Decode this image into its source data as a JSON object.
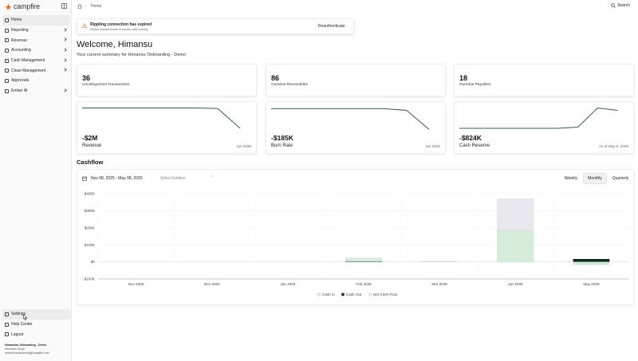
{
  "brand": {
    "name": "campfire"
  },
  "sidebar": {
    "items": [
      {
        "label": "Home",
        "active": true,
        "chevron": false
      },
      {
        "label": "Reporting",
        "active": false,
        "chevron": true
      },
      {
        "label": "Revenue",
        "active": false,
        "chevron": true
      },
      {
        "label": "Accounting",
        "active": false,
        "chevron": true
      },
      {
        "label": "Cash Management",
        "active": false,
        "chevron": true
      },
      {
        "label": "Close Management",
        "active": false,
        "chevron": true
      },
      {
        "label": "Approvals",
        "active": false,
        "chevron": false
      },
      {
        "label": "Ember AI",
        "active": false,
        "chevron": true
      }
    ],
    "bottom": [
      {
        "label": "Settings"
      },
      {
        "label": "Help Center"
      },
      {
        "label": "Logout"
      }
    ],
    "org": {
      "name": "Himanshu Onboarding - Demo",
      "user": "Himanshu Singh",
      "email": "himanshuonboarding@campfire.com"
    }
  },
  "topbar": {
    "breadcrumb": "Home",
    "search_label": "Search"
  },
  "alert": {
    "title": "Rippling connection has expired",
    "subtitle": "Please reauthenticate to resolve data syncing.",
    "button": "Reauthenticate"
  },
  "welcome": {
    "title": "Welcome, Himansu",
    "subtitle": "Your current summary for Himansu Onboarding - Demo"
  },
  "stats": [
    {
      "value": "36",
      "label": "Uncategorized Transactions"
    },
    {
      "value": "86",
      "label": "Overdue Receivables"
    },
    {
      "value": "18",
      "label": "Overdue Payables"
    }
  ],
  "metrics": [
    {
      "value": "-$2M",
      "label": "Revenue",
      "date": "Apr 2026",
      "trend": [
        0.95,
        0.95,
        0.95,
        0.95,
        0.95,
        0.95,
        0.93,
        0.1
      ]
    },
    {
      "value": "-$185K",
      "label": "Burn Rate",
      "date": "Apr 2026",
      "trend": [
        0.92,
        0.92,
        0.92,
        0.92,
        0.92,
        0.92,
        0.85,
        0.05
      ]
    },
    {
      "value": "-$824K",
      "label": "Cash Reserve",
      "date": "As of May 6, 2026",
      "trend": [
        0.1,
        0.1,
        0.1,
        0.1,
        0.1,
        0.1,
        0.15,
        0.95,
        0.85
      ]
    }
  ],
  "cashflow": {
    "title": "Cashflow",
    "date_range": "Nov 08, 2025 - May 08, 2026",
    "entity_placeholder": "Select Entities",
    "periods": [
      "Weekly",
      "Monthly",
      "Quarterly"
    ],
    "active_period": "Monthly"
  },
  "colors": {
    "cash_in": "#d6ecdb",
    "cash_out": "#e8e8ee",
    "net": "#0f2a1c",
    "spark": "#3a5a4a"
  },
  "chart_data": {
    "type": "bar",
    "categories": [
      "Nov 2025",
      "Dec 2025",
      "Jan 2026",
      "Feb 2026",
      "Mar 2026",
      "Apr 2026",
      "May 2026"
    ],
    "ylim": [
      -100000,
      400000
    ],
    "yticks": [
      "$400K",
      "$300K",
      "$200K",
      "$100K",
      "$0",
      "-$100K"
    ],
    "ytick_values": [
      400000,
      300000,
      200000,
      100000,
      0,
      -100000
    ],
    "legend": [
      "Cash In",
      "Cash Out",
      "Net Cash Flow"
    ],
    "series": [
      {
        "name": "Cash In",
        "values": [
          0,
          0,
          0,
          18000,
          2000,
          185000,
          0
        ]
      },
      {
        "name": "Cash Out",
        "values": [
          0,
          0,
          0,
          5000,
          1000,
          185000,
          12000
        ]
      },
      {
        "name": "Net Cash Flow",
        "values": [
          0,
          0,
          0,
          2000,
          0,
          0,
          -18000
        ]
      }
    ]
  }
}
